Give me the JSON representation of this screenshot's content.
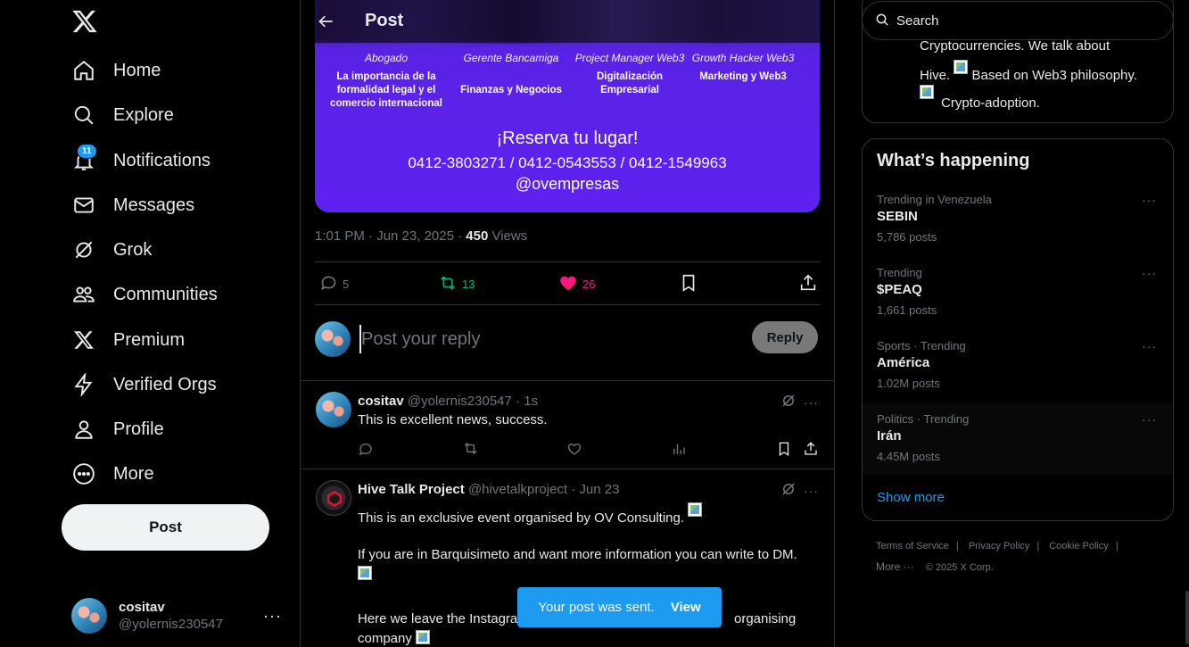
{
  "sidebar": {
    "nav": [
      {
        "label": "Home",
        "icon": "home-icon"
      },
      {
        "label": "Explore",
        "icon": "search-icon"
      },
      {
        "label": "Notifications",
        "icon": "bell-icon",
        "badge": "11"
      },
      {
        "label": "Messages",
        "icon": "envelope-icon"
      },
      {
        "label": "Grok",
        "icon": "grok-icon"
      },
      {
        "label": "Communities",
        "icon": "people-icon"
      },
      {
        "label": "Premium",
        "icon": "x-logo-icon"
      },
      {
        "label": "Verified Orgs",
        "icon": "lightning-icon"
      },
      {
        "label": "Profile",
        "icon": "person-icon"
      },
      {
        "label": "More",
        "icon": "more-circle-icon"
      }
    ],
    "post_label": "Post",
    "account": {
      "name": "cositav",
      "handle": "@yolernis230547",
      "more": "···"
    }
  },
  "header": {
    "title": "Post"
  },
  "banner": {
    "columns": [
      {
        "role": "Abogado",
        "topic": "La importancia de la formalidad legal y el comercio internacional"
      },
      {
        "role": "Gerente Bancamiga",
        "topic": "Finanzas y Negocios"
      },
      {
        "role": "Project Manager Web3",
        "topic": "Digitalización Empresarial"
      },
      {
        "role": "Growth Hacker Web3",
        "topic": "Marketing y Web3"
      }
    ],
    "reserva": "¡Reserva tu lugar!",
    "phones": "0412-3803271 / 0412-0543553 / 0412-1549963",
    "handle": "@ovempresas"
  },
  "post_meta": {
    "time": "1:01 PM · Jun 23, 2025 · ",
    "views_count": "450",
    "views_label": " Views"
  },
  "actions": {
    "replies": "5",
    "reposts": "13",
    "likes": "26"
  },
  "reply_box": {
    "placeholder": "Post your reply",
    "button": "Reply"
  },
  "replies": [
    {
      "name": "cositav",
      "handle": "@yolernis230547",
      "time": "1s",
      "text": "This is excellent news, success."
    },
    {
      "name": "Hive Talk Project",
      "handle": "@hivetalkproject",
      "time": "Jun 23",
      "para1": "This is an exclusive event organised by OV Consulting.",
      "para2": "If you are in Barquisimeto and want more information you can write to DM.",
      "para3a": "Here we leave the Instagra",
      "para3b": "organising",
      "para4": "company"
    }
  ],
  "toast": {
    "text": "Your post was sent.",
    "action": "View"
  },
  "search": {
    "placeholder": "Search"
  },
  "about_card": {
    "line1": "Cryptocurrencies.      We talk about",
    "line2a": "Hive.",
    "line2b": "Based on Web3 philosophy.",
    "line3": "Crypto-adoption."
  },
  "whats_happening": {
    "title": "What’s happening",
    "trends": [
      {
        "context": "Trending in Venezuela",
        "title": "SEBIN",
        "count": "5,786 posts"
      },
      {
        "context": "Trending",
        "title": "$PEAQ",
        "count": "1,661 posts"
      },
      {
        "context": "Sports · Trending",
        "title": "América",
        "count": "1.02M posts"
      },
      {
        "context": "Politics · Trending",
        "title": "Irán",
        "count": "4.45M posts"
      }
    ],
    "show_more": "Show more"
  },
  "footer": {
    "links": [
      "Terms of Service",
      "Privacy Policy",
      "Cookie Policy"
    ],
    "more": "More ···",
    "copyright": "© 2025 X Corp."
  },
  "colors": {
    "accent": "#1d9bf0",
    "repost": "#00ba7c",
    "like": "#f91880",
    "banner": "#5e21f0"
  }
}
